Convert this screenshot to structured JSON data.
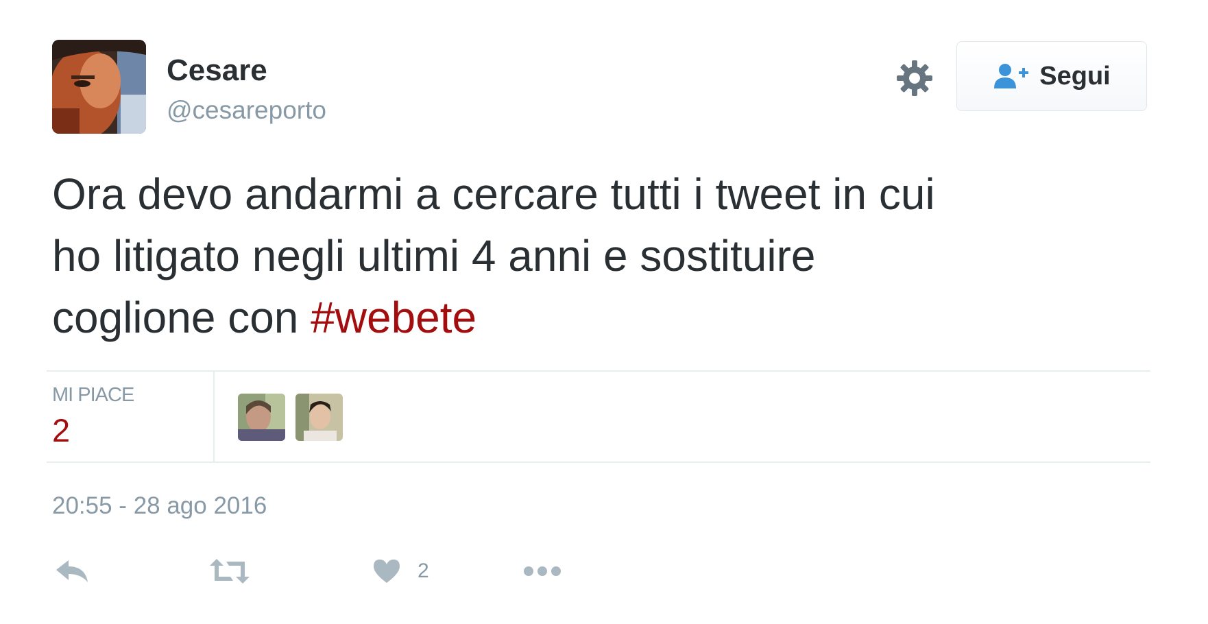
{
  "author": {
    "display_name": "Cesare",
    "handle": "@cesareporto"
  },
  "header": {
    "settings_icon": "gear-icon",
    "follow_label": "Segui",
    "follow_icon": "add-user-icon"
  },
  "tweet": {
    "lines": [
      "Ora devo andarmi a cercare tutti i tweet in cui",
      "ho litigato negli ultimi 4 anni e sostituire"
    ],
    "line3_text": "coglione con ",
    "hashtag": "#webete"
  },
  "stats": {
    "likes_label": "MI PIACE",
    "likes_count": "2"
  },
  "timestamp": "20:55 - 28 ago 2016",
  "actions": {
    "reply_icon": "reply-icon",
    "retweet_icon": "retweet-icon",
    "like_icon": "heart-icon",
    "like_count": "2",
    "more_icon": "more-icon"
  },
  "colors": {
    "text": "#292f33",
    "muted": "#8899a6",
    "accent": "#a30d0d",
    "follow_icon": "#3b94d9",
    "divider": "#e8edf0"
  }
}
